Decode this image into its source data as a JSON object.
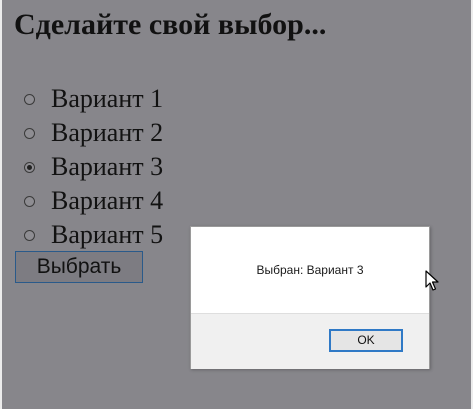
{
  "heading": "Сделайте свой выбор...",
  "options": [
    {
      "label": "Вариант 1",
      "checked": false
    },
    {
      "label": "Вариант 2",
      "checked": false
    },
    {
      "label": "Вариант 3",
      "checked": true
    },
    {
      "label": "Вариант 4",
      "checked": false
    },
    {
      "label": "Вариант 5",
      "checked": false
    }
  ],
  "choose_button": "Выбрать",
  "dialog": {
    "message": "Выбран: Вариант 3",
    "ok_label": "OK"
  },
  "icons": {
    "cursor": "arrow-cursor-icon"
  },
  "colors": {
    "page_background": "#87868b",
    "dialog_background": "#ffffff",
    "dialog_footer": "#f0f0f0",
    "ok_border": "#2f79c6"
  }
}
